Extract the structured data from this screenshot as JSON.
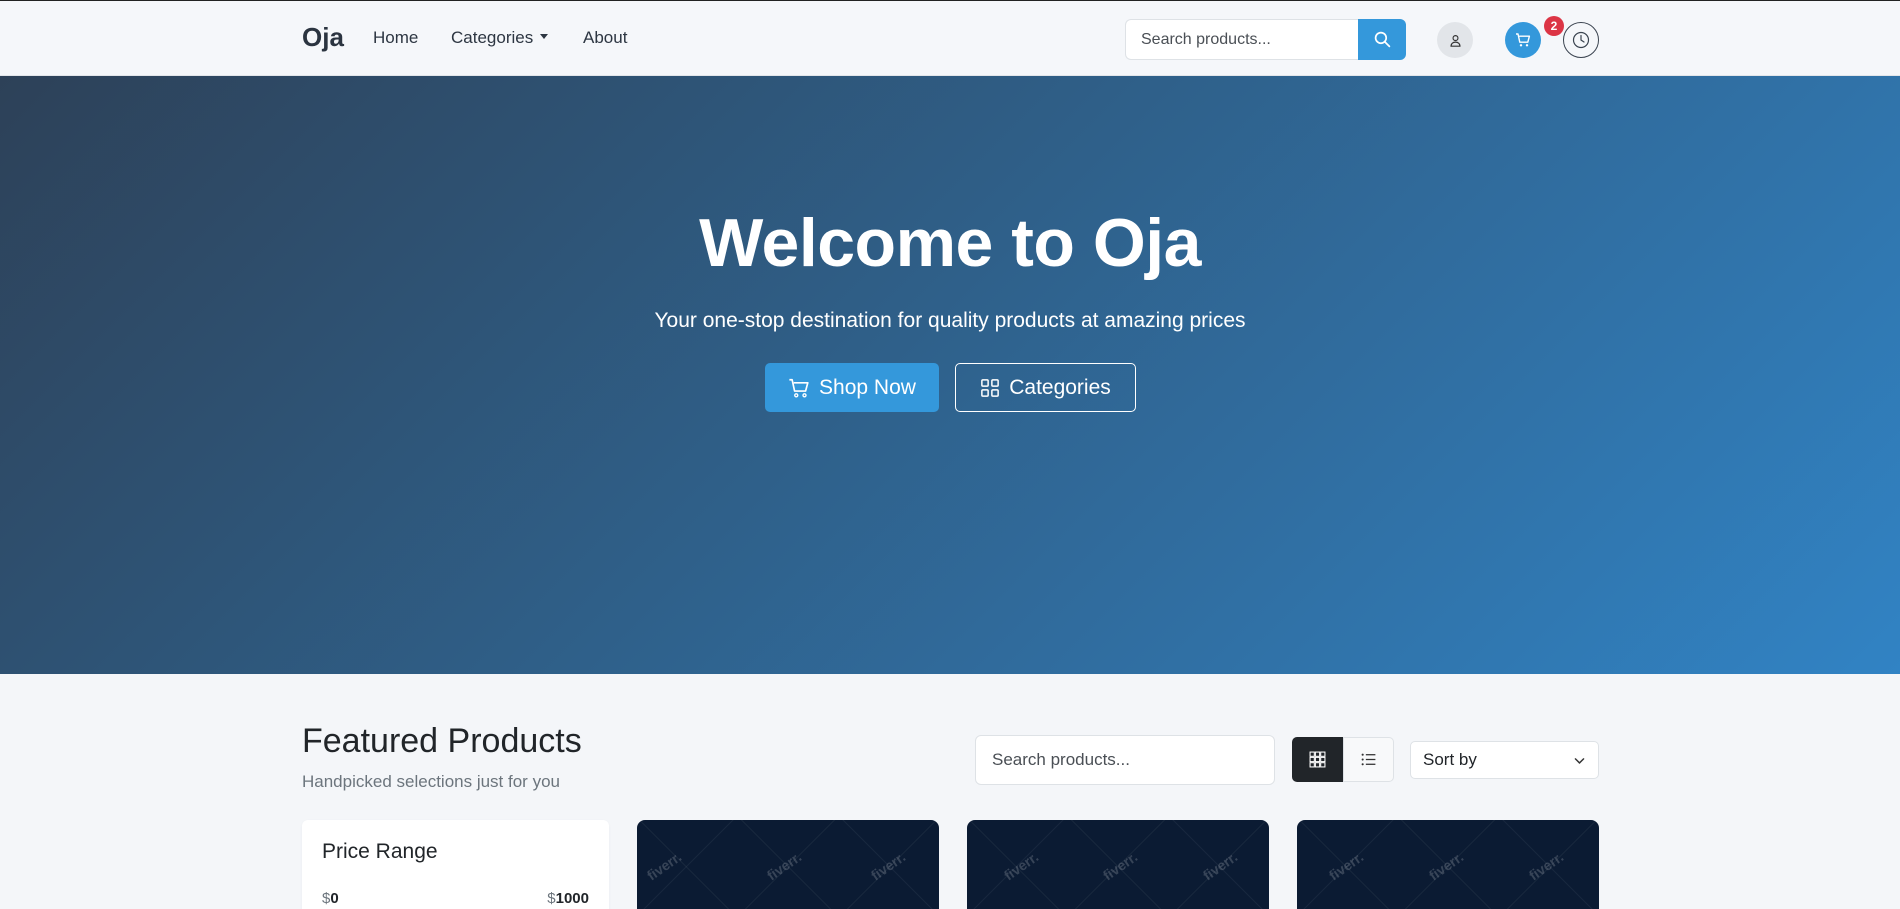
{
  "nav": {
    "brand": "Oja",
    "links": {
      "home": "Home",
      "categories": "Categories",
      "about": "About"
    },
    "search_placeholder": "Search products...",
    "cart_count": "2"
  },
  "hero": {
    "title": "Welcome to Oja",
    "subtitle": "Your one-stop destination for quality products at amazing prices",
    "shop_now": "Shop Now",
    "categories": "Categories"
  },
  "featured": {
    "title": "Featured Products",
    "subtitle": "Handpicked selections just for you",
    "search_placeholder": "Search products...",
    "sort_label": "Sort by"
  },
  "filter": {
    "title": "Price Range",
    "currency": "$",
    "min": "0",
    "max": "1000"
  },
  "product_images": {
    "watermark": "fiverr."
  },
  "colors": {
    "accent": "#3498db",
    "badge": "#dc3545",
    "dark": "#212529"
  }
}
